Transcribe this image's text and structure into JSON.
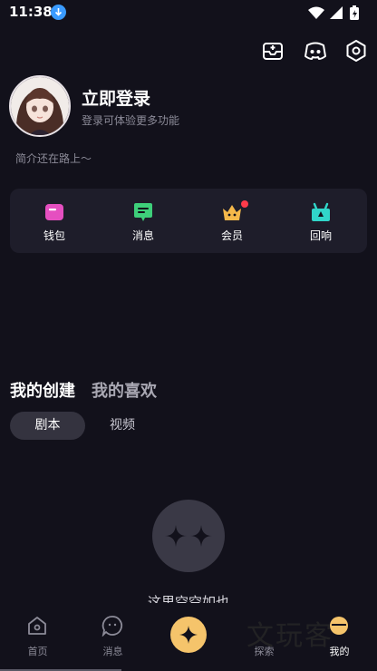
{
  "status_bar": {
    "time": "11:38"
  },
  "profile": {
    "login_title": "立即登录",
    "login_subtitle": "登录可体验更多功能",
    "bio": "简介还在路上～"
  },
  "quick_actions": [
    {
      "label": "钱包",
      "icon": "wallet-icon",
      "color": "#e54fc0"
    },
    {
      "label": "消息",
      "icon": "message-icon",
      "color": "#3ecf7a"
    },
    {
      "label": "会员",
      "icon": "crown-icon",
      "color": "#f5b84a",
      "badge": true
    },
    {
      "label": "回响",
      "icon": "gift-icon",
      "color": "#31d6c9"
    }
  ],
  "content_tabs": {
    "created": "我的创建",
    "liked": "我的喜欢"
  },
  "filter_chips": {
    "script": "剧本",
    "video": "视频"
  },
  "empty_state": {
    "text": "这里空空如也"
  },
  "bottom_nav": {
    "home": "首页",
    "messages": "消息",
    "explore": "探索",
    "mine": "我的"
  },
  "watermark": "文玩客",
  "colors": {
    "background": "#12111b",
    "card": "#1e1d2a",
    "accent": "#f5c46b"
  }
}
